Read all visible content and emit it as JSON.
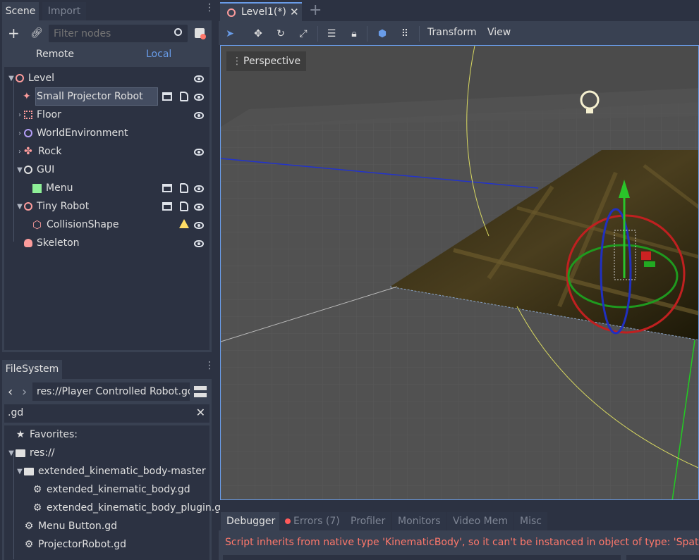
{
  "scene_dock": {
    "tabs": [
      "Scene",
      "Import"
    ],
    "filter_placeholder": "Filter nodes",
    "remote_label": "Remote",
    "local_label": "Local",
    "nodes": [
      {
        "label": "Level"
      },
      {
        "label": "Small Projector Robot"
      },
      {
        "label": "Floor"
      },
      {
        "label": "WorldEnvironment"
      },
      {
        "label": "Rock"
      },
      {
        "label": "GUI"
      },
      {
        "label": "Menu"
      },
      {
        "label": "Tiny Robot"
      },
      {
        "label": "CollisionShape"
      },
      {
        "label": "Skeleton"
      }
    ]
  },
  "filesystem": {
    "tab": "FileSystem",
    "path": "res://Player Controlled Robot.gd",
    "search_value": ".gd",
    "favorites_label": "Favorites:",
    "items": [
      {
        "label": "res://"
      },
      {
        "label": "extended_kinematic_body-master"
      },
      {
        "label": "extended_kinematic_body.gd"
      },
      {
        "label": "extended_kinematic_body_plugin.g"
      },
      {
        "label": "Menu Button.gd"
      },
      {
        "label": "ProjectorRobot.gd"
      }
    ]
  },
  "editor": {
    "scene_tab": "Level1(*)",
    "add_tab": "+",
    "menus": [
      "Transform",
      "View"
    ],
    "viewport_label": "Perspective"
  },
  "bottom": {
    "tabs": [
      "Debugger",
      "Errors (7)",
      "Profiler",
      "Monitors",
      "Video Mem",
      "Misc"
    ],
    "error_message": "Script inherits from native type 'KinematicBody', so it can't be instanced in object of type: 'Spatial'"
  },
  "colors": {
    "accent": "#699ce8",
    "error": "#ff786b",
    "node_red": "#fc9c9c",
    "warning": "#ffdd65"
  }
}
